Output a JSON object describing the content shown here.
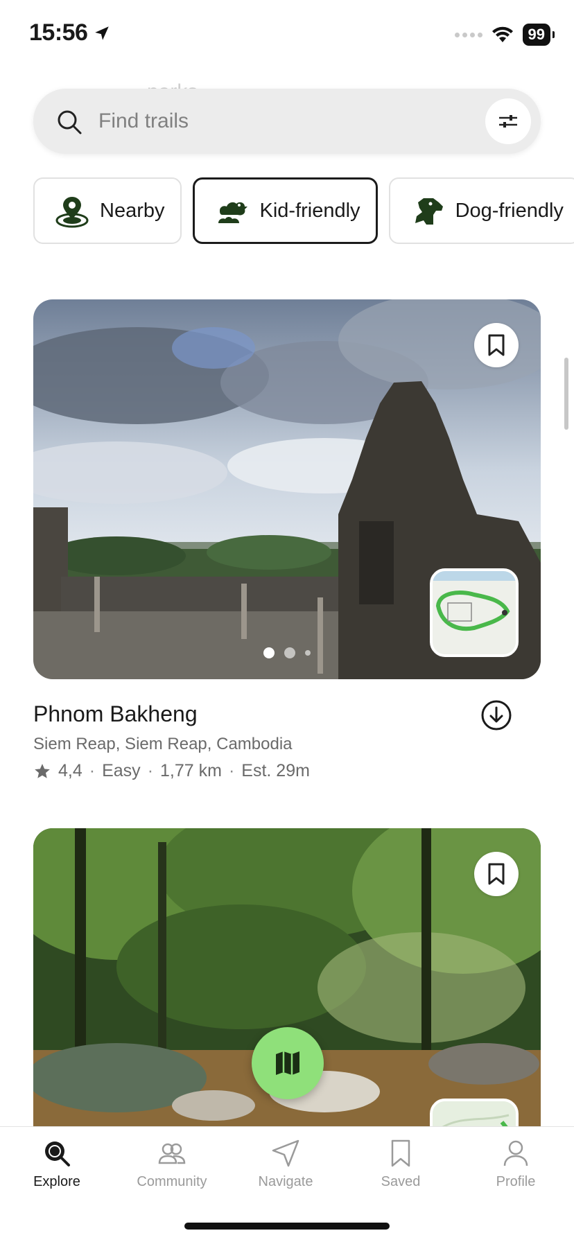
{
  "status_bar": {
    "time": "15:56",
    "battery": "99"
  },
  "search": {
    "ghost_text": "parks",
    "placeholder": "Find trails"
  },
  "chips": [
    {
      "label": "Nearby",
      "icon": "location-pin-icon",
      "selected": false
    },
    {
      "label": "Kid-friendly",
      "icon": "ducks-icon",
      "selected": true
    },
    {
      "label": "Dog-friendly",
      "icon": "dog-icon",
      "selected": false
    }
  ],
  "trails": [
    {
      "name": "Phnom Bakheng",
      "location": "Siem Reap, Siem Reap, Cambodia",
      "rating": "4,4",
      "difficulty": "Easy",
      "distance": "1,77 km",
      "duration": "Est. 29m"
    }
  ],
  "meta_separator": "·",
  "tabs": [
    {
      "label": "Explore",
      "icon": "explore-icon",
      "active": true
    },
    {
      "label": "Community",
      "icon": "community-icon",
      "active": false
    },
    {
      "label": "Navigate",
      "icon": "navigate-icon",
      "active": false
    },
    {
      "label": "Saved",
      "icon": "bookmark-icon",
      "active": false
    },
    {
      "label": "Profile",
      "icon": "profile-icon",
      "active": false
    }
  ],
  "colors": {
    "accent_green": "#8fe07a",
    "icon_dark_green": "#1f3d1a",
    "text_primary": "#1a1a1a",
    "text_secondary": "#6a6a6a"
  }
}
